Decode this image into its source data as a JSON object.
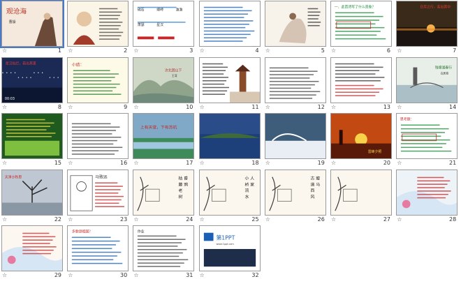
{
  "window": {
    "view": "slide-sorter"
  },
  "slides": [
    {
      "num": "1",
      "kind": "title",
      "title": "观沧海",
      "sub": "曹操",
      "bg": "#f4e9dc",
      "accent": "#c0392b"
    },
    {
      "num": "2",
      "kind": "portrait",
      "bg": "#fbf5e8",
      "accent": "#a23b2a"
    },
    {
      "num": "3",
      "kind": "phonetic",
      "bg": "#ffffff",
      "accent": "#2e7d32",
      "words": [
        "碣石",
        "竦峙",
        "澹澹",
        "萧瑟",
        "星汉"
      ]
    },
    {
      "num": "4",
      "kind": "textblue",
      "bg": "#ffffff",
      "accent": "#1a5fb4"
    },
    {
      "num": "5",
      "kind": "ink",
      "bg": "#f7f3ea",
      "accent": "#5a4632"
    },
    {
      "num": "6",
      "kind": "textgreen",
      "bg": "#ffffff",
      "accent": "#1b8a3a",
      "title": "一、此首诗写了什么景象？"
    },
    {
      "num": "7",
      "kind": "sunset",
      "bg": "#3a2a1a",
      "accent": "#e48a2a",
      "title": "日月之行，若出其中"
    },
    {
      "num": "8",
      "kind": "night",
      "bg": "#1b2a55",
      "accent": "#e53935",
      "title": "星汉灿烂，若出其里",
      "time": "00:03"
    },
    {
      "num": "9",
      "kind": "summary",
      "bg": "#fdfbe7",
      "accent": "#2e7d32",
      "title": "小结："
    },
    {
      "num": "10",
      "kind": "landscape",
      "bg": "#cfd8c6",
      "accent": "#a33",
      "title": "次北固山下",
      "sub": "王湾"
    },
    {
      "num": "11",
      "kind": "pagoda",
      "bg": "#ffffff",
      "accent": "#8a4b2a"
    },
    {
      "num": "12",
      "kind": "text",
      "bg": "#ffffff",
      "accent": "#333"
    },
    {
      "num": "13",
      "kind": "textred",
      "bg": "#ffffff",
      "accent": "#c62828"
    },
    {
      "num": "14",
      "kind": "lake",
      "bg": "#e8efe9",
      "accent": "#2e7d32",
      "title": "钱塘湖春行",
      "sub": "白居易"
    },
    {
      "num": "15",
      "kind": "greentext",
      "bg": "#1f5a1f",
      "accent": "#f2e24a"
    },
    {
      "num": "16",
      "kind": "text",
      "bg": "#ffffff",
      "accent": "#333"
    },
    {
      "num": "17",
      "kind": "river",
      "bg": "#7fa9c7",
      "accent": "#c62828",
      "title": "上有天堂，下有苏杭"
    },
    {
      "num": "18",
      "kind": "bluelake",
      "bg": "#2a4d8a",
      "accent": "#ffffff"
    },
    {
      "num": "19",
      "kind": "winter",
      "bg": "#3d5d7a",
      "accent": "#ffffff"
    },
    {
      "num": "20",
      "kind": "sunsetpagoda",
      "bg": "#c24a12",
      "accent": "#f8d34a",
      "title": "雷峰夕照"
    },
    {
      "num": "21",
      "kind": "textgreen",
      "bg": "#ffffff",
      "accent": "#c62828",
      "title": "思考题："
    },
    {
      "num": "22",
      "kind": "tree",
      "bg": "#bfc8d2",
      "accent": "#c62828",
      "title": "天净沙秋思"
    },
    {
      "num": "23",
      "kind": "sketch",
      "bg": "#ffffff",
      "accent": "#333",
      "title": "马致远"
    },
    {
      "num": "24",
      "kind": "crow",
      "bg": "#fbf7ee",
      "accent": "#333",
      "title": "枯藤老树昏鸦"
    },
    {
      "num": "25",
      "kind": "bridge",
      "bg": "#fbf7ee",
      "accent": "#333",
      "title": "小桥流水人家"
    },
    {
      "num": "26",
      "kind": "road",
      "bg": "#fbf7ee",
      "accent": "#333",
      "title": "古道西风瘦马"
    },
    {
      "num": "27",
      "kind": "tree2",
      "bg": "#fbf7ee",
      "accent": "#333"
    },
    {
      "num": "28",
      "kind": "flower",
      "bg": "#eef3f8",
      "accent": "#c62828"
    },
    {
      "num": "29",
      "kind": "flower2",
      "bg": "#fdf7f2",
      "accent": "#c62828"
    },
    {
      "num": "30",
      "kind": "list",
      "bg": "#ffffff",
      "accent": "#c62828",
      "title": "多歌颂祖国？"
    },
    {
      "num": "31",
      "kind": "text",
      "bg": "#ffffff",
      "accent": "#333",
      "title": "作业"
    },
    {
      "num": "32",
      "kind": "logo",
      "bg": "#ffffff",
      "accent": "#1a5fb4",
      "title": "第1PPT",
      "sub": "www.1ppt.com"
    }
  ],
  "star_glyph": "☆"
}
